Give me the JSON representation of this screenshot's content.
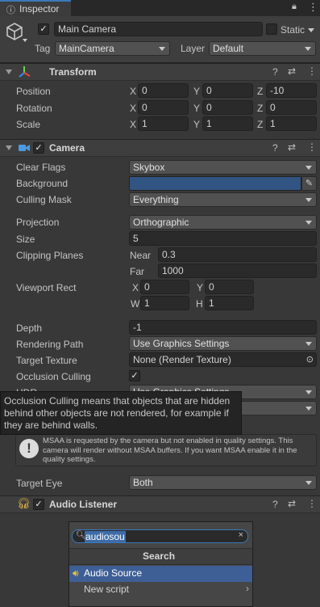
{
  "window": {
    "tab_title": "Inspector"
  },
  "gameobject": {
    "name": "Main Camera",
    "static_label": "Static",
    "tag_label": "Tag",
    "tag_value": "MainCamera",
    "layer_label": "Layer",
    "layer_value": "Default"
  },
  "transform": {
    "title": "Transform",
    "position": {
      "label": "Position",
      "x": "0",
      "y": "0",
      "z": "-10"
    },
    "rotation": {
      "label": "Rotation",
      "x": "0",
      "y": "0",
      "z": "0"
    },
    "scale": {
      "label": "Scale",
      "x": "1",
      "y": "1",
      "z": "1"
    },
    "axis_x": "X",
    "axis_y": "Y",
    "axis_z": "Z"
  },
  "camera": {
    "title": "Camera",
    "clear_flags": {
      "label": "Clear Flags",
      "value": "Skybox"
    },
    "background": {
      "label": "Background",
      "color": "#315482"
    },
    "culling_mask": {
      "label": "Culling Mask",
      "value": "Everything"
    },
    "projection": {
      "label": "Projection",
      "value": "Orthographic"
    },
    "size": {
      "label": "Size",
      "value": "5"
    },
    "clipping": {
      "label": "Clipping Planes",
      "near_label": "Near",
      "near": "0.3",
      "far_label": "Far",
      "far": "1000"
    },
    "viewport": {
      "label": "Viewport Rect",
      "x_label": "X",
      "x": "0",
      "y_label": "Y",
      "y": "0",
      "w_label": "W",
      "w": "1",
      "h_label": "H",
      "h": "1"
    },
    "depth": {
      "label": "Depth",
      "value": "-1"
    },
    "rendering_path": {
      "label": "Rendering Path",
      "value": "Use Graphics Settings"
    },
    "target_texture": {
      "label": "Target Texture",
      "value": "None (Render Texture)"
    },
    "occlusion": {
      "label": "Occlusion Culling"
    },
    "hdr": {
      "label": "HDR",
      "value": "Use Graphics Settings"
    },
    "tooltip": "Occlusion Culling means that objects that are hidden behind other objects are not rendered, for example if they are behind walls.",
    "msaa_warning": "MSAA is requested by the camera but not enabled in quality settings. This camera will render without MSAA buffers. If you want MSAA enable it in the quality settings.",
    "target_eye": {
      "label": "Target Eye",
      "value": "Both"
    }
  },
  "audio_listener": {
    "title": "Audio Listener"
  },
  "add_component": {
    "search_value": "audiosou",
    "header": "Search",
    "items": [
      {
        "label": "Audio Source"
      },
      {
        "label": "New script"
      }
    ]
  },
  "colors": {
    "accent": "#3e5f96",
    "panel": "#383838",
    "background_swatch": "#315482"
  }
}
